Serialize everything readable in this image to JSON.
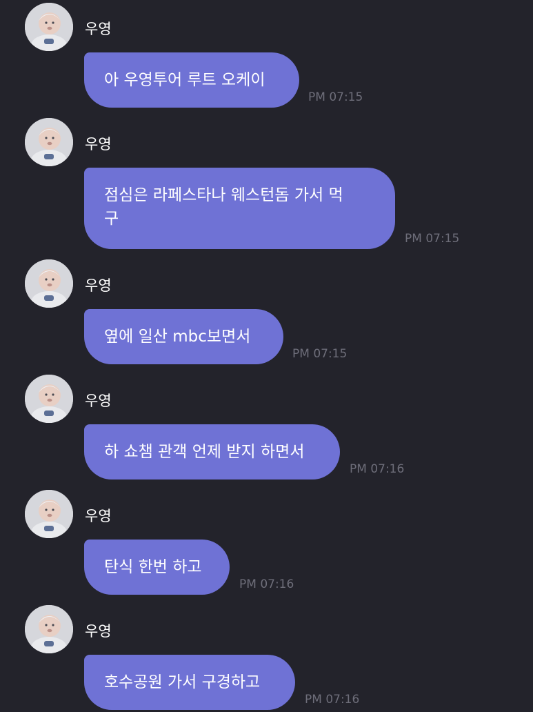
{
  "messages": [
    {
      "sender": "우영",
      "text": "아 우영투어 루트 오케이",
      "time": "PM 07:15"
    },
    {
      "sender": "우영",
      "text": "점심은 라페스타나 웨스턴돔 가서 먹구",
      "time": "PM 07:15"
    },
    {
      "sender": "우영",
      "text": "옆에 일산 mbc보면서",
      "time": "PM 07:15"
    },
    {
      "sender": "우영",
      "text": "하 쇼챔 관객 언제 받지 하면서",
      "time": "PM 07:16"
    },
    {
      "sender": "우영",
      "text": "탄식 한번 하고",
      "time": "PM 07:16"
    },
    {
      "sender": "우영",
      "text": "호수공원 가서 구경하고",
      "time": "PM 07:16"
    }
  ],
  "colors": {
    "background": "#23232b",
    "bubble": "#6f72d5",
    "timestamp": "#6e6e7a",
    "text": "#ffffff"
  },
  "icons": {
    "avatar": "baby-photo-avatar"
  }
}
